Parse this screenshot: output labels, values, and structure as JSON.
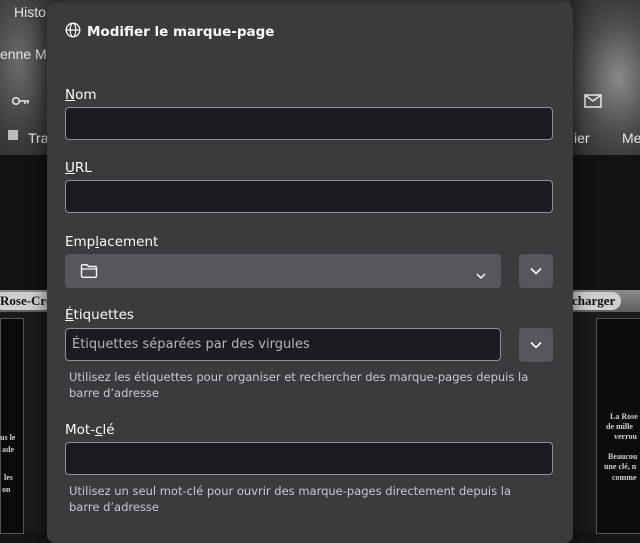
{
  "background": {
    "menu_history": "Histo",
    "menu_name": "enne Ma",
    "menu_tra": "Tra",
    "menu_ier": "ier",
    "menu_me": "Me",
    "pill_left": "Rose-Cro",
    "pill_right": "charger",
    "left_text_1": "us le",
    "left_text_2": "ade",
    "left_text_3": "les",
    "left_text_4": "on",
    "right_text_1": "La Rose",
    "right_text_2": "de mille",
    "right_text_3": "verrou",
    "right_text_4": "Beaucou",
    "right_text_5": "une clé, n",
    "right_text_6": "comme"
  },
  "dialog": {
    "title": "Modifier le marque-page",
    "title_icon": "globe-icon",
    "name_label_access": "N",
    "name_label_rest": "om",
    "name_value": "",
    "url_label_access": "U",
    "url_label_rest": "RL",
    "url_value": "",
    "location_label_pre": "Emp",
    "location_label_access": "l",
    "location_label_post": "acement",
    "location_icon": "folder-icon",
    "location_value": "",
    "tags_label_access": "É",
    "tags_label_rest": "tiquettes",
    "tags_placeholder": "Étiquettes séparées par des virgules",
    "tags_hint": "Utilisez les étiquettes pour organiser et rechercher des marque-pages depuis la barre d’adresse",
    "keyword_label_pre": "Mot-",
    "keyword_label_access": "c",
    "keyword_label_post": "lé",
    "keyword_value": "",
    "keyword_hint": "Utilisez un seul mot-clé pour ouvrir des marque-pages directement depuis la barre d’adresse"
  }
}
